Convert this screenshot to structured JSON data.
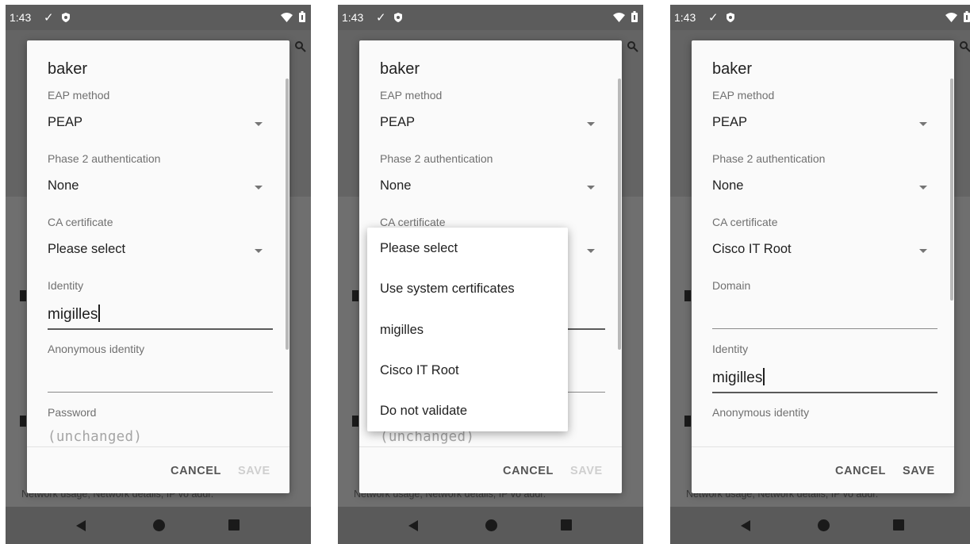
{
  "status_bar": {
    "time": "1:43"
  },
  "background": {
    "footer_text": "Network usage, Network details, IP vo addr."
  },
  "dialog": {
    "title": "baker",
    "eap_method": {
      "label": "EAP method",
      "value": "PEAP"
    },
    "phase2": {
      "label": "Phase 2 authentication",
      "value": "None"
    },
    "ca_certificate": {
      "label": "CA certificate",
      "value_initial": "Please select",
      "value_selected": "Cisco IT Root"
    },
    "domain": {
      "label": "Domain",
      "value": ""
    },
    "identity": {
      "label": "Identity",
      "value": "migilles"
    },
    "anonymous_identity": {
      "label": "Anonymous identity",
      "value": ""
    },
    "password": {
      "label": "Password",
      "placeholder": "(unchanged)"
    },
    "cancel_label": "CANCEL",
    "save_label": "SAVE"
  },
  "ca_menu": {
    "options": [
      "Please select",
      "Use system certificates",
      "migilles",
      "Cisco IT Root",
      "Do not validate"
    ]
  },
  "colors": {
    "dim_background": "#6f6f6f",
    "dialog": "#fafafa",
    "disabled_button": "#cfcfcf"
  }
}
